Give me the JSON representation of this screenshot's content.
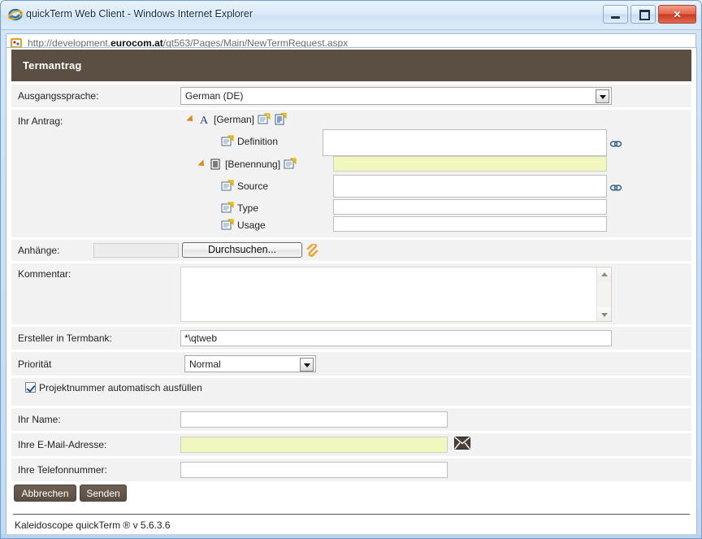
{
  "window": {
    "title": "quickTerm Web Client - Windows Internet Explorer",
    "icon": "internet-explorer-icon",
    "minimize_label": "",
    "maximize_label": "",
    "close_label": "✕"
  },
  "address_bar": {
    "icon": "site-favicon-icon",
    "url_prefix": "http://development.",
    "url_domain": "eurocom.at",
    "url_suffix": "/qt563/Pages/Main/NewTermRequest.aspx",
    "url_full": "http://development.eurocom.at/qt563/Pages/Main/NewTermRequest.aspx"
  },
  "header": {
    "title": "Termantrag",
    "background_color": "#5b4e43"
  },
  "form": {
    "source_language": {
      "label": "Ausgangssprache:",
      "value": "German (DE)"
    },
    "request": {
      "label": "Ihr Antrag:",
      "tree": [
        {
          "label": "[German]",
          "icon": "language-letter-a-icon",
          "expander": "expander-triangle-icon",
          "extra_icons": [
            "add-note-icon",
            "add-entry-icon"
          ],
          "level": 0,
          "field": null
        },
        {
          "label": "Definition",
          "icon": "note-icon",
          "level": 1,
          "field": {
            "value": "",
            "required": false,
            "link_icon": "chain-link-icon"
          }
        },
        {
          "label": "[Benennung]",
          "icon": "term-icon",
          "expander": "expander-triangle-icon",
          "extra_icons": [
            "add-note-icon"
          ],
          "level": 1,
          "field": {
            "value": "",
            "required": true,
            "link_icon": null
          }
        },
        {
          "label": "Source",
          "icon": "note-icon",
          "level": 2,
          "field": {
            "value": "",
            "required": false,
            "link_icon": "chain-link-icon"
          }
        },
        {
          "label": "Type",
          "icon": "note-icon",
          "level": 2,
          "field": {
            "value": "",
            "required": false,
            "link_icon": null
          }
        },
        {
          "label": "Usage",
          "icon": "note-icon",
          "level": 2,
          "field": {
            "value": "",
            "required": false,
            "link_icon": null
          }
        }
      ]
    },
    "attachments": {
      "label": "Anhänge:",
      "file_value": "",
      "browse_label": "Durchsuchen...",
      "attach_icon": "paperclip-icon"
    },
    "comment": {
      "label": "Kommentar:",
      "value": ""
    },
    "creator": {
      "label": "Ersteller in Termbank:",
      "value": "*\\qtweb"
    },
    "priority": {
      "label": "Priorität",
      "value": "Normal"
    },
    "auto_project_number": {
      "label": "Projektnummer automatisch ausfüllen",
      "checked": true
    },
    "your_name": {
      "label": "Ihr Name:",
      "value": ""
    },
    "your_email": {
      "label": "Ihre E-Mail-Adresse:",
      "value": "",
      "required": true,
      "icon": "envelope-icon"
    },
    "your_phone": {
      "label": "Ihre Telefonnummer:",
      "value": ""
    },
    "buttons": {
      "cancel": "Abbrechen",
      "submit": "Senden"
    }
  },
  "footer": {
    "text": "Kaleidoscope quickTerm ® v 5.6.3.6"
  },
  "colors": {
    "header_brown": "#5b4e43",
    "row_gray": "#f2f2f2",
    "required_yellow": "#f2f7c0",
    "chrome_blue": "#c3daf0"
  }
}
